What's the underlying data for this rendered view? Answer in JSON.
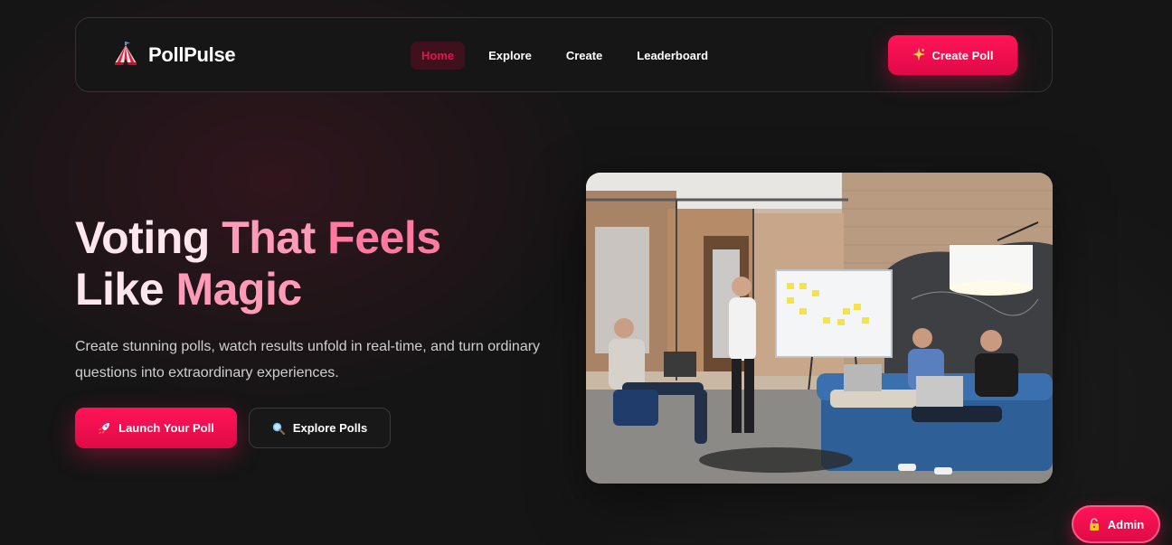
{
  "brand": {
    "name": "PollPulse",
    "icon": "circus-tent-icon"
  },
  "nav": {
    "links": [
      {
        "label": "Home",
        "active": true
      },
      {
        "label": "Explore",
        "active": false
      },
      {
        "label": "Create",
        "active": false
      },
      {
        "label": "Leaderboard",
        "active": false
      }
    ],
    "cta": {
      "label": "Create Poll",
      "icon": "sparkle-icon"
    }
  },
  "hero": {
    "title_words": [
      "Voting",
      "That",
      "Feels",
      "Like",
      "Magic"
    ],
    "subtitle": "Create stunning polls, watch results unfold in real-time, and turn ordinary questions into extraordinary experiences.",
    "primary_button": {
      "label": "Launch Your Poll",
      "icon": "rocket-icon"
    },
    "secondary_button": {
      "label": "Explore Polls",
      "icon": "magnifier-icon"
    },
    "image": {
      "subject": "team meeting in office with whiteboard"
    }
  },
  "admin": {
    "label": "Admin",
    "icon": "lock-icon"
  },
  "colors": {
    "accent": "#ff1458",
    "background": "#151515",
    "title_light": "#fde6ee",
    "title_pink": "#ff9ab8"
  }
}
